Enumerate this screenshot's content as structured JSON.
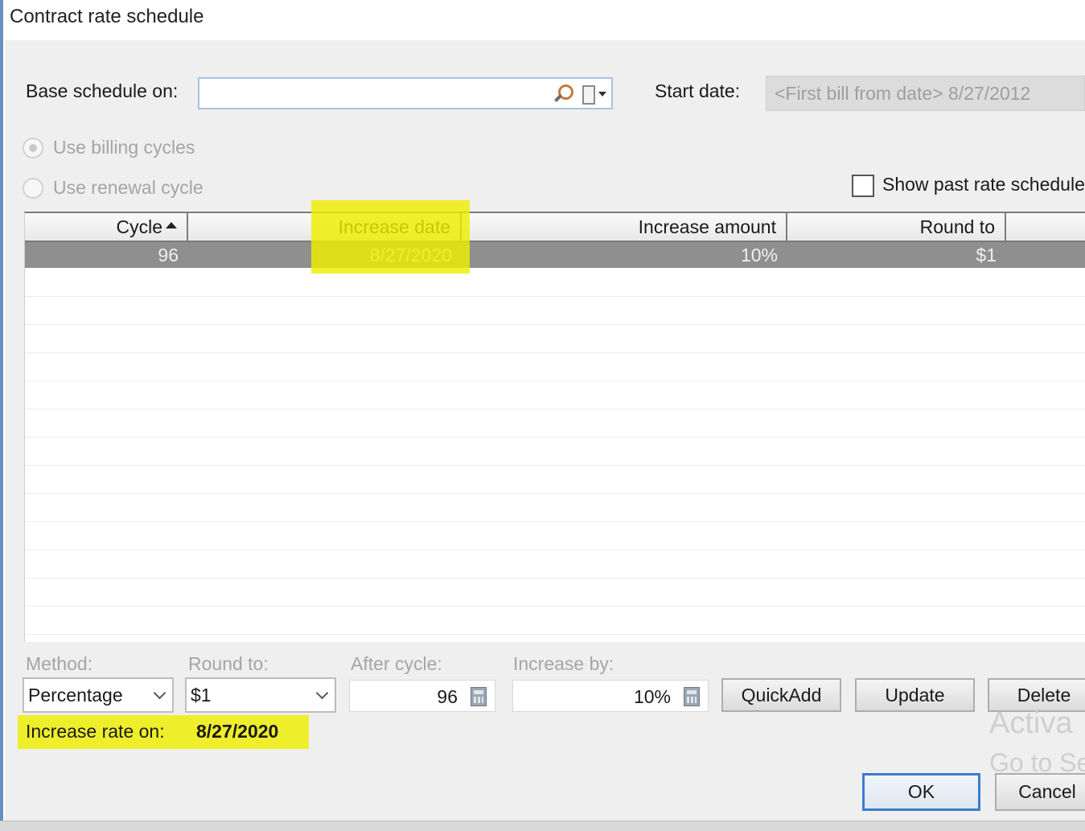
{
  "window": {
    "title": "Contract rate schedule"
  },
  "base_schedule": {
    "label": "Base schedule on:",
    "value": ""
  },
  "start_date": {
    "label": "Start date:",
    "value": "<First bill from date>  8/27/2012"
  },
  "radios": [
    {
      "label": "Use billing cycles",
      "checked": true,
      "enabled": false
    },
    {
      "label": "Use renewal cycle",
      "checked": false,
      "enabled": false
    }
  ],
  "show_past": {
    "label": "Show past rate schedules",
    "checked": false
  },
  "grid": {
    "columns": [
      "Cycle",
      "Increase date",
      "Increase amount",
      "Round to"
    ],
    "rows": [
      {
        "cycle": "96",
        "increase_date": "8/27/2020",
        "increase_amount": "10%",
        "round_to": "$1"
      }
    ]
  },
  "method": {
    "label": "Method:",
    "value": "Percentage"
  },
  "round_to": {
    "label": "Round to:",
    "value": "$1"
  },
  "after_cycle": {
    "label": "After cycle:",
    "value": "96"
  },
  "increase_by": {
    "label": "Increase by:",
    "value": "10%"
  },
  "buttons": {
    "quickadd": "QuickAdd",
    "update": "Update",
    "delete": "Delete",
    "ok": "OK",
    "cancel": "Cancel"
  },
  "increase_rate": {
    "label": "Increase rate on:",
    "value": "8/27/2020"
  },
  "watermark": {
    "line1": "Activa",
    "line2": "Go to Se"
  },
  "colors": {
    "highlight": "#eeee00",
    "selected_row": "#8f8f8f",
    "default_button_border": "#3b7cd1"
  }
}
